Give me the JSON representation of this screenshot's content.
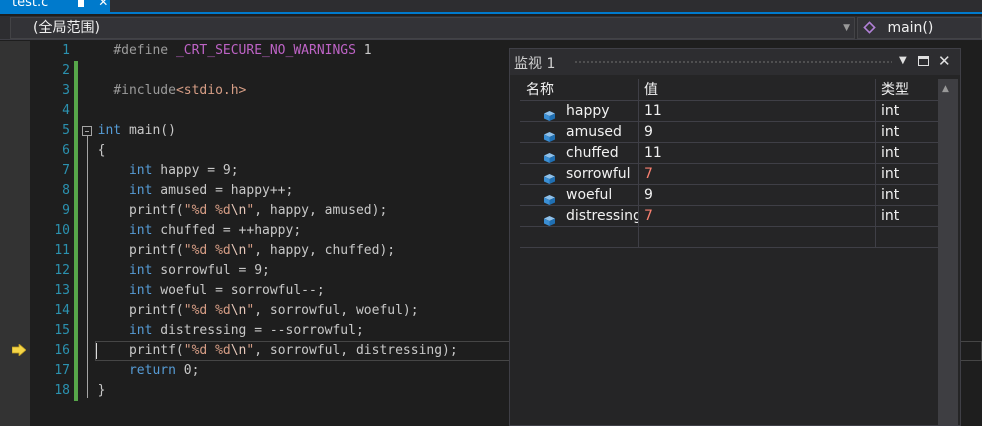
{
  "tab": {
    "title": "test.c",
    "close": "✕"
  },
  "nav": {
    "scope": "(全局范围)",
    "function": "main()"
  },
  "editor": {
    "line_numbers": [
      "1",
      "2",
      "3",
      "4",
      "5",
      "6",
      "7",
      "8",
      "9",
      "10",
      "11",
      "12",
      "13",
      "14",
      "15",
      "16",
      "17",
      "18"
    ],
    "current_line": 16
  },
  "code": {
    "l1": {
      "directive": "#define ",
      "macro": "_CRT_SECURE_NO_WARNINGS",
      "value": " 1"
    },
    "l3": {
      "directive": "#include",
      "header": "<stdio.h>"
    },
    "l5": {
      "kw": "int",
      "rest": " main()"
    },
    "l6": "{",
    "l7": {
      "kw": "int",
      "rest": " happy = 9;"
    },
    "l8": {
      "kw": "int",
      "rest": " amused = happy++;"
    },
    "l9": {
      "fn": "printf(",
      "str": "\"%d %d",
      "esc": "\\n",
      "strend": "\"",
      "rest": ", happy, amused);"
    },
    "l10": {
      "kw": "int",
      "rest": " chuffed = ++happy;"
    },
    "l11": {
      "fn": "printf(",
      "str": "\"%d %d",
      "esc": "\\n",
      "strend": "\"",
      "rest": ", happy, chuffed);"
    },
    "l12": {
      "kw": "int",
      "rest": " sorrowful = 9;"
    },
    "l13": {
      "kw": "int",
      "rest": " woeful = sorrowful--;"
    },
    "l14": {
      "fn": "printf(",
      "str": "\"%d %d",
      "esc": "\\n",
      "strend": "\"",
      "rest": ", sorrowful, woeful);"
    },
    "l15": {
      "kw": "int",
      "rest": " distressing = --sorrowful;"
    },
    "l16": {
      "fn": "printf(",
      "str": "\"%d %d",
      "esc": "\\n",
      "strend": "\"",
      "rest": ", sorrowful, distressing);"
    },
    "l17": {
      "kw": "return",
      "rest": " 0;"
    },
    "l18": "}"
  },
  "watch": {
    "title": "监视 1",
    "columns": {
      "name": "名称",
      "value": "值",
      "type": "类型"
    },
    "rows": [
      {
        "name": "happy",
        "value": "11",
        "type": "int",
        "changed": false
      },
      {
        "name": "amused",
        "value": "9",
        "type": "int",
        "changed": false
      },
      {
        "name": "chuffed",
        "value": "11",
        "type": "int",
        "changed": false
      },
      {
        "name": "sorrowful",
        "value": "7",
        "type": "int",
        "changed": true
      },
      {
        "name": "woeful",
        "value": "9",
        "type": "int",
        "changed": false
      },
      {
        "name": "distressing",
        "value": "7",
        "type": "int",
        "changed": true
      }
    ]
  },
  "colors": {
    "accent": "#007acc",
    "changed_value": "#f88070",
    "keyword": "#569cd6",
    "string": "#d69d85",
    "line_number": "#2b91af",
    "change_bar": "#57a64a"
  }
}
